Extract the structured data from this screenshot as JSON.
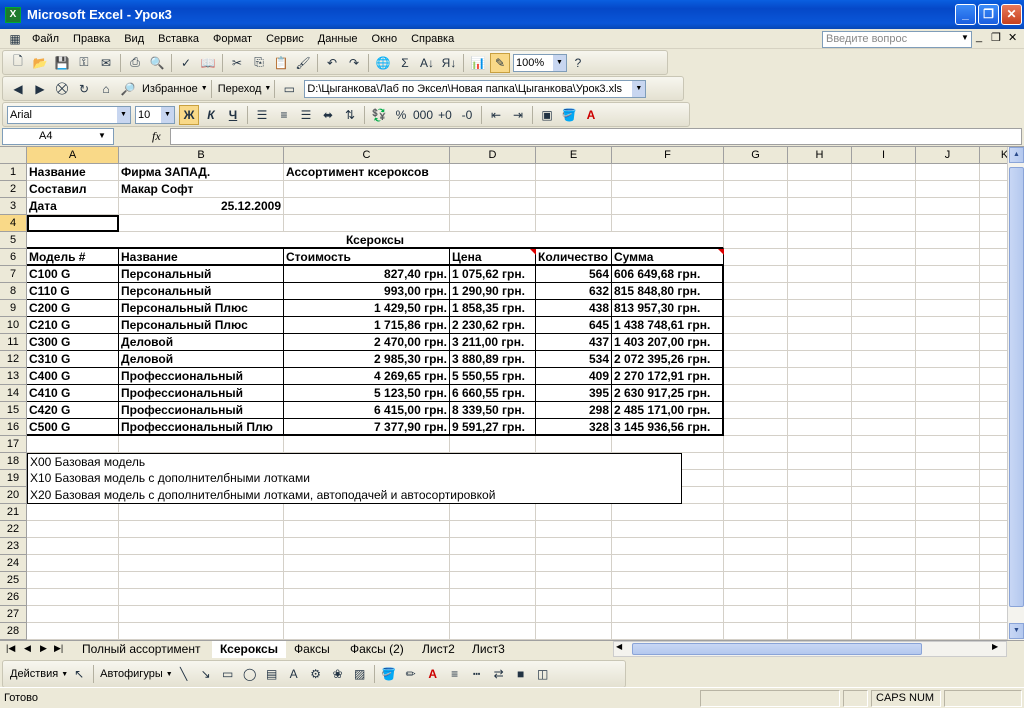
{
  "window": {
    "title": "Microsoft Excel - Урок3",
    "icon": "excel-icon"
  },
  "menu": {
    "items": [
      "Файл",
      "Правка",
      "Вид",
      "Вставка",
      "Формат",
      "Сервис",
      "Данные",
      "Окно",
      "Справка"
    ],
    "ask_placeholder": "Введите вопрос"
  },
  "toolbar_standard": {
    "zoom": "100%"
  },
  "toolbar_web": {
    "favorites": "Избранное",
    "goto": "Переход",
    "address": "D:\\Цыганкова\\Лаб по Эксел\\Новая папка\\Цыганкова\\Урок3.xls"
  },
  "toolbar_format": {
    "font": "Arial",
    "size": "10",
    "bold": "Ж",
    "italic": "К",
    "underline": "Ч"
  },
  "formula": {
    "namebox": "A4",
    "fx": "fx",
    "content": ""
  },
  "columns": [
    {
      "label": "A",
      "width": 92
    },
    {
      "label": "B",
      "width": 165
    },
    {
      "label": "C",
      "width": 166
    },
    {
      "label": "D",
      "width": 86
    },
    {
      "label": "E",
      "width": 76
    },
    {
      "label": "F",
      "width": 112
    },
    {
      "label": "G",
      "width": 64
    },
    {
      "label": "H",
      "width": 64
    },
    {
      "label": "I",
      "width": 64
    },
    {
      "label": "J",
      "width": 64
    },
    {
      "label": "K",
      "width": 50
    }
  ],
  "rows": [
    "1",
    "2",
    "3",
    "4",
    "5",
    "6",
    "7",
    "8",
    "9",
    "10",
    "11",
    "12",
    "13",
    "14",
    "15",
    "16",
    "17",
    "18",
    "19",
    "20",
    "21",
    "22",
    "23",
    "24",
    "25",
    "26",
    "27",
    "28"
  ],
  "cells": {
    "r1": {
      "a": "Название",
      "b": "Фирма ЗАПАД.",
      "c": "Ассортимент ксероксов"
    },
    "r2": {
      "a": "Составил",
      "b": "Макар Софт"
    },
    "r3": {
      "a": "Дата",
      "b": "25.12.2009"
    },
    "r5": {
      "merged": "Ксероксы"
    },
    "r6": {
      "a": "Модель #",
      "b": "Название",
      "c": "Стоимость",
      "d": "Цена",
      "e": "Количество",
      "f": "Сумма"
    },
    "data": [
      {
        "model": "C100 G",
        "name": "Персональный",
        "cost": "827,40 грн.",
        "price": "1 075,62 грн.",
        "qty": "564",
        "sum": "606 649,68 грн."
      },
      {
        "model": "C110 G",
        "name": "Персональный",
        "cost": "993,00 грн.",
        "price": "1 290,90 грн.",
        "qty": "632",
        "sum": "815 848,80 грн."
      },
      {
        "model": "C200 G",
        "name": "Персональный Плюс",
        "cost": "1 429,50 грн.",
        "price": "1 858,35 грн.",
        "qty": "438",
        "sum": "813 957,30 грн."
      },
      {
        "model": "C210 G",
        "name": "Персональный Плюс",
        "cost": "1 715,86 грн.",
        "price": "2 230,62 грн.",
        "qty": "645",
        "sum": "1 438 748,61 грн."
      },
      {
        "model": "C300 G",
        "name": "Деловой",
        "cost": "2 470,00 грн.",
        "price": "3 211,00 грн.",
        "qty": "437",
        "sum": "1 403 207,00 грн."
      },
      {
        "model": "C310 G",
        "name": "Деловой",
        "cost": "2 985,30 грн.",
        "price": "3 880,89 грн.",
        "qty": "534",
        "sum": "2 072 395,26 грн."
      },
      {
        "model": "C400 G",
        "name": "Профессиональный",
        "cost": "4 269,65 грн.",
        "price": "5 550,55 грн.",
        "qty": "409",
        "sum": "2 270 172,91 грн."
      },
      {
        "model": "C410 G",
        "name": "Профессиональный",
        "cost": "5 123,50 грн.",
        "price": "6 660,55 грн.",
        "qty": "395",
        "sum": "2 630 917,25 грн."
      },
      {
        "model": "C420 G",
        "name": "Профессиональный",
        "cost": "6 415,00 грн.",
        "price": "8 339,50 грн.",
        "qty": "298",
        "sum": "2 485 171,00 грн."
      },
      {
        "model": "C500 G",
        "name": "Профессиональный Плю",
        "cost": "7 377,90 грн.",
        "price": "9 591,27 грн.",
        "qty": "328",
        "sum": "3 145 936,56 грн."
      }
    ],
    "notes": [
      "X00 Базовая модель",
      "X10 Базовая модель с дополнителбными лотками",
      "X20 Базовая модель с дополнителбными лотками, автоподачей и автосортировкой"
    ]
  },
  "sheet_tabs": [
    "Полный ассортимент",
    "Ксероксы",
    "Факсы",
    "Факсы (2)",
    "Лист2",
    "Лист3"
  ],
  "active_tab": "Ксероксы",
  "drawing": {
    "actions": "Действия",
    "autoshapes": "Автофигуры"
  },
  "status": {
    "ready": "Готово",
    "caps": "CAPS NUM"
  }
}
